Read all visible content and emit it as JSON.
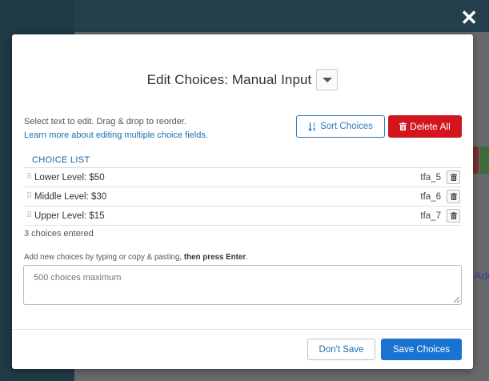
{
  "window": {
    "close_glyph": "✕"
  },
  "backdrop": {
    "add_text": "Add"
  },
  "modal": {
    "title": "Edit Choices: Manual Input",
    "instructions": "Select text to edit. Drag & drop to reorder.",
    "learn_more": "Learn more about editing multiple choice fields.",
    "sort_button": "Sort Choices",
    "sort_icon": "sort-ascending-icon",
    "delete_all_button": "Delete All",
    "delete_icon": "trash-icon",
    "list_header": "CHOICE LIST",
    "choices": [
      {
        "label": "Lower Level: $50",
        "id": "tfa_5"
      },
      {
        "label": "Middle Level: $30",
        "id": "tfa_6"
      },
      {
        "label": "Upper Level: $15",
        "id": "tfa_7"
      }
    ],
    "count_text": "3 choices entered",
    "add_help_prefix": "Add new choices by typing or copy & pasting, ",
    "add_help_bold": "then press Enter",
    "add_help_suffix": ".",
    "textarea_placeholder": "500 choices maximum",
    "dont_save_button": "Don't Save",
    "save_button": "Save Choices"
  },
  "colors": {
    "primary": "#1a73d1",
    "danger": "#d3151e",
    "link": "#1a6fb0"
  }
}
